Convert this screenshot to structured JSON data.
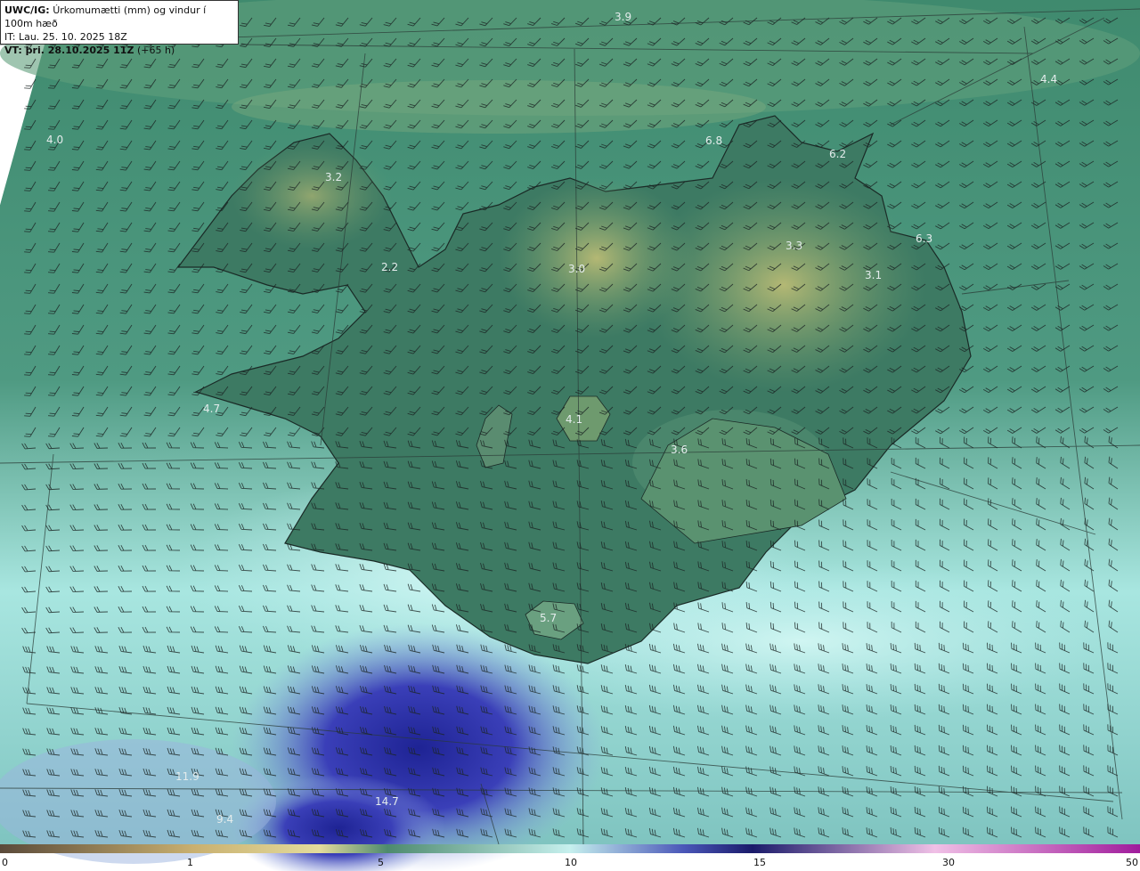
{
  "header": {
    "model": "UWC/IG:",
    "title": "Úrkomumætti (mm) og vindur í 100m hæð",
    "init_time": "IT: Lau. 25. 10. 2025 18Z",
    "valid_time": "VT: þri. 28.10.2025 11Z",
    "lead": "(+65 h)"
  },
  "map_labels": [
    {
      "text": "3.9",
      "name": "value-label-north"
    },
    {
      "text": "4.4",
      "name": "value-label-northeast-sea"
    },
    {
      "text": "4.0",
      "name": "value-label-northwest-sea"
    },
    {
      "text": "6.8",
      "name": "value-label-north-coast"
    },
    {
      "text": "6.2",
      "name": "value-label-langanes"
    },
    {
      "text": "3.2",
      "name": "value-label-westfjords"
    },
    {
      "text": "3.3",
      "name": "value-label-northeast-highlands"
    },
    {
      "text": "6.3",
      "name": "value-label-east-coast"
    },
    {
      "text": "2.2",
      "name": "value-label-westfjords-south"
    },
    {
      "text": "3.0",
      "name": "value-label-north-central"
    },
    {
      "text": "3.1",
      "name": "value-label-east-highlands"
    },
    {
      "text": "4.7",
      "name": "value-label-west-sea"
    },
    {
      "text": "4.1",
      "name": "value-label-hofsjokull"
    },
    {
      "text": "3.6",
      "name": "value-label-vatnajokull"
    },
    {
      "text": "5.7",
      "name": "value-label-myrdalsjokull"
    },
    {
      "text": "11.9",
      "name": "value-label-southwest-sea"
    },
    {
      "text": "14.7",
      "name": "value-label-south-sea"
    },
    {
      "text": "9.4",
      "name": "value-label-south-sea-2"
    }
  ],
  "legend": {
    "ticks": [
      "0",
      "1",
      "5",
      "10",
      "15",
      "30",
      "50"
    ],
    "colors": [
      "#5a4a3a",
      "#a6925c",
      "#e8e0a0",
      "#7ab88c",
      "#2f7a6a",
      "#b8ecec",
      "#2a2f96",
      "#2a1f70",
      "#e8a0d8",
      "#a030a0"
    ]
  },
  "colors": {
    "sea_north": "#4c8a74",
    "land_low": "#2f6b56",
    "highlands": "#a7b06c",
    "sea_south_light": "#c8f2f0",
    "heavy_precip": "#3a3cb0"
  }
}
